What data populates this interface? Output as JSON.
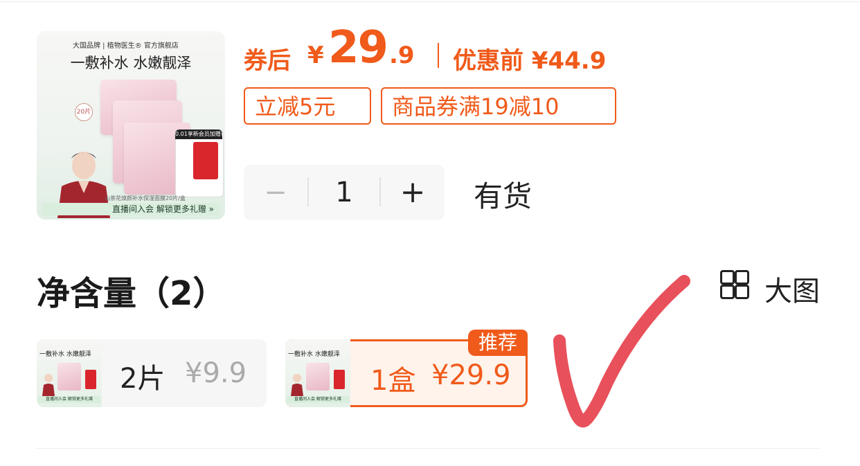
{
  "product": {
    "image_brand": "大国品牌 | 植物医生® 官方旗舰店",
    "image_slogan": "一敷补水 水嫩靓泽",
    "image_count_badge": "20片",
    "image_gift_label": "0.01享新会员加赠礼",
    "image_note": "山茶花焕颜补水保湿面膜20片/盒",
    "image_bottom_text": "直播间入会  解锁更多礼赠 »"
  },
  "price": {
    "after_coupon_label": "券后",
    "currency": "¥",
    "integer": "29",
    "decimal": ".9",
    "original_label": "优惠前 ¥44.9"
  },
  "coupons": [
    {
      "label": "立减5元"
    },
    {
      "label": "商品券满19减10"
    }
  ],
  "quantity": {
    "minus": "−",
    "value": "1",
    "plus": "+",
    "stock_status": "有货"
  },
  "spec_section": {
    "title": "净含量（2）",
    "big_view_label": "大图"
  },
  "options": [
    {
      "spec": "2片",
      "price": "¥9.9",
      "mini_slogan": "一敷补水 水嫩靓泽",
      "mini_bar": "直播间入会 解锁更多礼赠"
    },
    {
      "spec": "1盒",
      "price": "¥29.9",
      "mini_slogan": "一敷补水 水嫩靓泽",
      "mini_bar": "直播间入会 解锁更多礼赠",
      "badge": "推荐",
      "selected": true
    }
  ],
  "colors": {
    "accent": "#f05a1a",
    "check_mark": "#e8505b"
  }
}
